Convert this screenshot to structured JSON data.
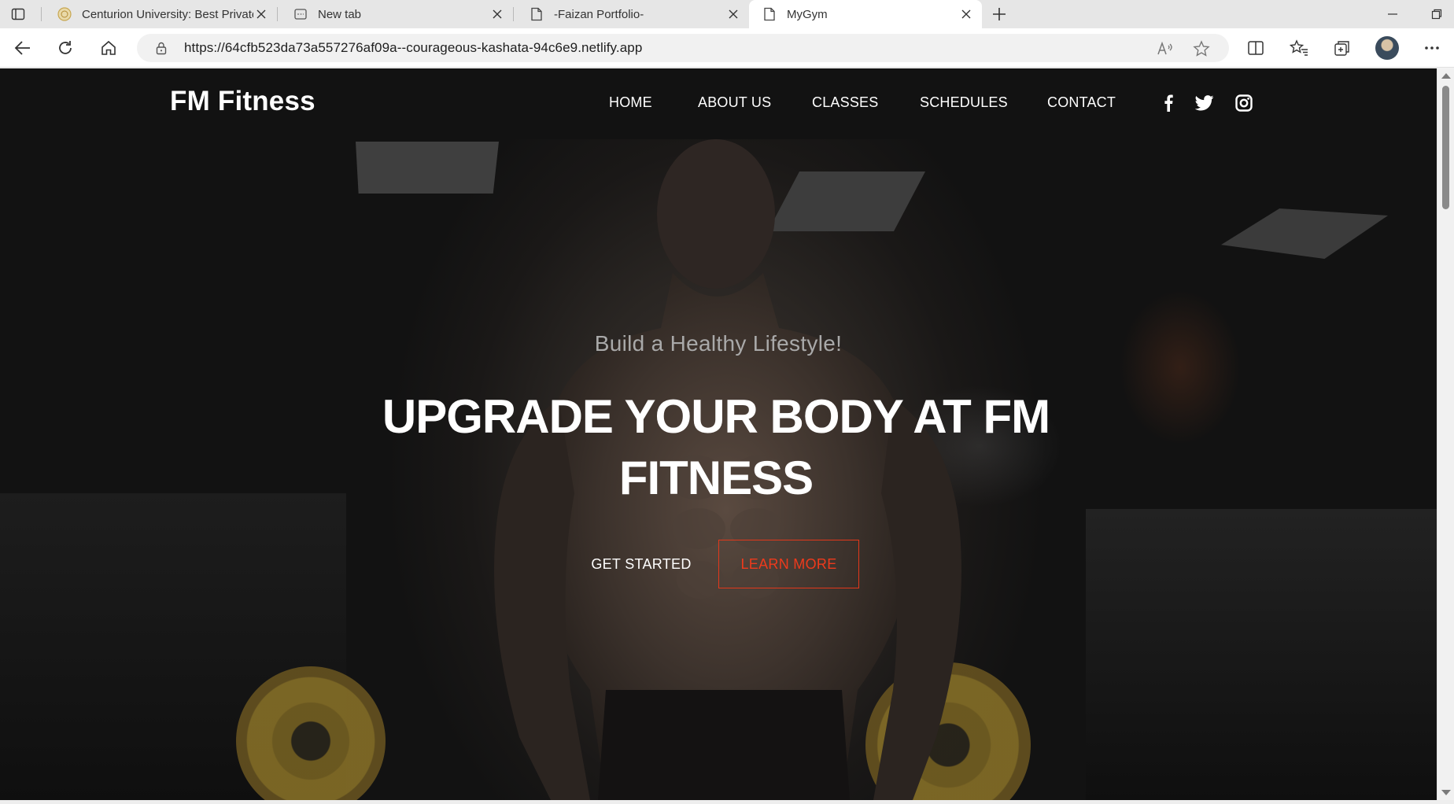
{
  "browser": {
    "tabs": [
      {
        "title": "Centurion University: Best Private",
        "favicon": "university-seal-icon",
        "active": false
      },
      {
        "title": "New tab",
        "favicon": "new-tab-page-icon",
        "active": false
      },
      {
        "title": "-Faizan Portfolio-",
        "favicon": "document-icon",
        "active": false
      },
      {
        "title": "MyGym",
        "favicon": "document-icon",
        "active": true
      }
    ],
    "url": "https://64cfb523da73a557276af09a--courageous-kashata-94c6e9.netlify.app"
  },
  "site": {
    "logo": "FM Fitness",
    "nav": [
      "HOME",
      "ABOUT US",
      "CLASSES",
      "SCHEDULES",
      "CONTACT"
    ],
    "social": [
      "facebook-icon",
      "twitter-icon",
      "instagram-icon"
    ],
    "hero": {
      "subtitle": "Build a Healthy Lifestyle!",
      "title": "UPGRADE YOUR BODY AT FM FITNESS",
      "primary_button": "GET STARTED",
      "secondary_button": "LEARN MORE"
    }
  },
  "colors": {
    "accent": "#e2381b",
    "header_bg": "#121212",
    "text": "#ffffff",
    "subtitle": "#a9a9a9"
  }
}
